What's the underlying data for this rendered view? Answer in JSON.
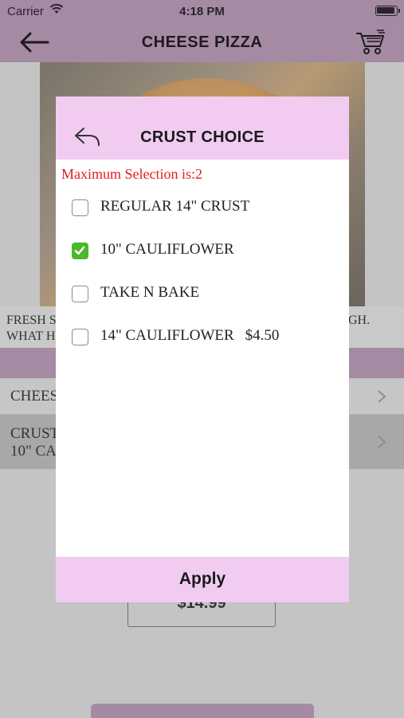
{
  "status_bar": {
    "carrier": "Carrier",
    "time": "4:18 PM"
  },
  "navbar": {
    "title": "CHEESE PIZZA",
    "back_icon": "arrow-left-icon",
    "cart_icon": "cart-icon"
  },
  "background": {
    "description_left": "FRESH S\nWHAT H",
    "description_right": "GH.",
    "row1_label": "CHEESE",
    "row2_label_line1": "CRUST",
    "row2_label_line2": "10\" CA",
    "price": "$14.99"
  },
  "modal": {
    "title": "CRUST CHOICE",
    "max_selection": "Maximum Selection is:2",
    "options": [
      {
        "label": "REGULAR 14\" CRUST",
        "price": "",
        "checked": false
      },
      {
        "label": "10\" CAULIFLOWER",
        "price": "",
        "checked": true
      },
      {
        "label": "TAKE N BAKE",
        "price": "",
        "checked": false
      },
      {
        "label": "14\" CAULIFLOWER",
        "price": "$4.50",
        "checked": false
      }
    ],
    "apply_label": "Apply"
  },
  "colors": {
    "accent_header": "#f1ccf0",
    "nav_dimmed": "#a48aa2",
    "checked": "#4cb82b",
    "warning": "#e51c1c"
  }
}
